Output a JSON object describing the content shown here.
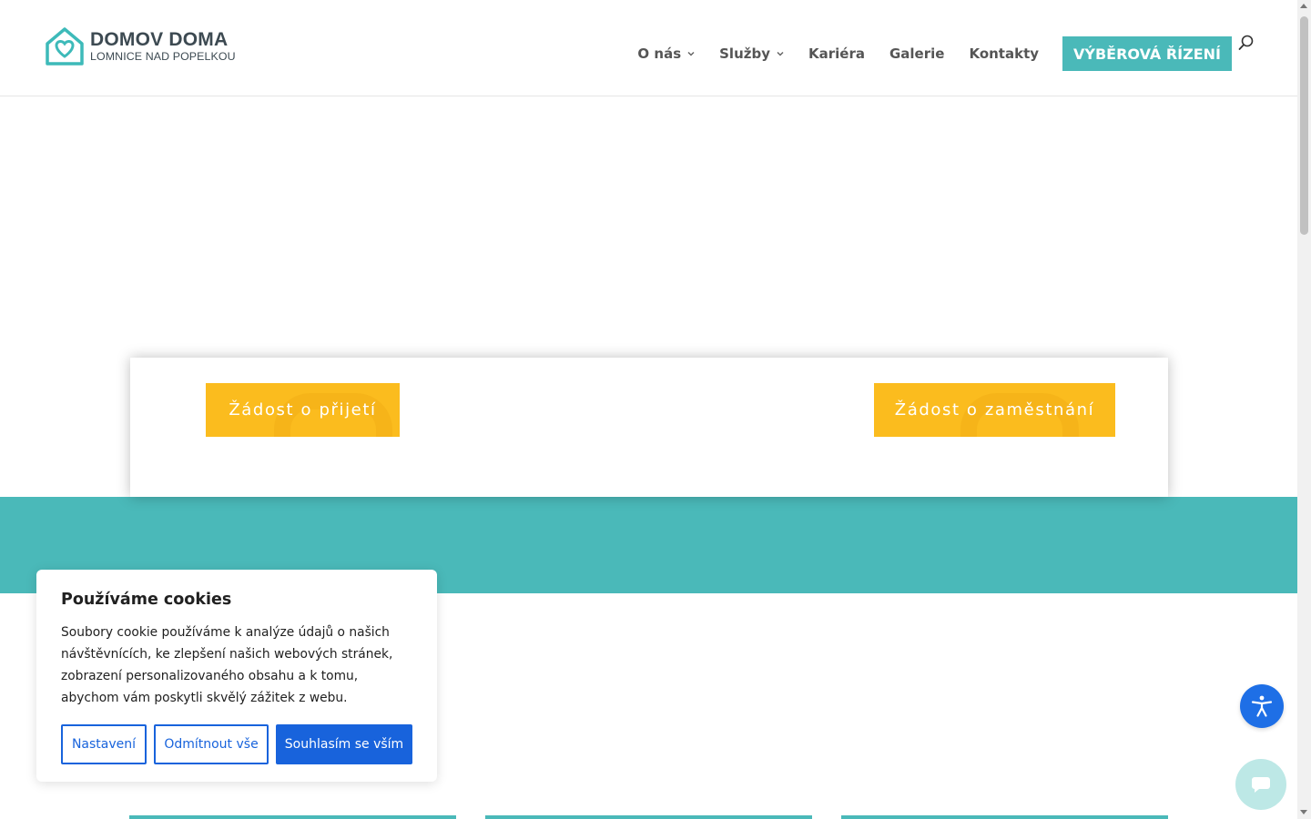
{
  "header": {
    "logo": {
      "name": "DOMOV DOMA",
      "subtitle": "LOMNICE NAD POPELKOU"
    },
    "nav": [
      {
        "label": "O nás",
        "has_dropdown": true
      },
      {
        "label": "Služby",
        "has_dropdown": true
      },
      {
        "label": "Kariéra",
        "has_dropdown": false
      },
      {
        "label": "Galerie",
        "has_dropdown": false
      },
      {
        "label": "Kontakty",
        "has_dropdown": false
      }
    ],
    "cta_label": "VÝBĚROVÁ ŘÍZENÍ",
    "search_icon": "search-icon"
  },
  "card": {
    "button_admission": "Žádost o přijetí",
    "button_employment": "Žádost o zaměstnání"
  },
  "cookie": {
    "title": "Používáme cookies",
    "text": "Soubory cookie používáme k analýze údajů o našich návštěvnících, ke zlepšení našich webových stránek, zobrazení personalizovaného obsahu a k tomu, abychom vám poskytli skvělý zážitek z webu.",
    "settings_label": "Nastavení",
    "reject_label": "Odmítnout vše",
    "accept_label": "Souhlasím se vším"
  },
  "floating": {
    "accessibility_icon": "accessibility-icon",
    "chat_icon": "chat-icon"
  },
  "colors": {
    "brand_teal": "#4ab9b9",
    "cta_yellow": "#fbbc1e",
    "cookie_blue": "#1863dc",
    "accessibility_blue": "#1e6fe6",
    "chat_bg": "#bde8e6"
  }
}
